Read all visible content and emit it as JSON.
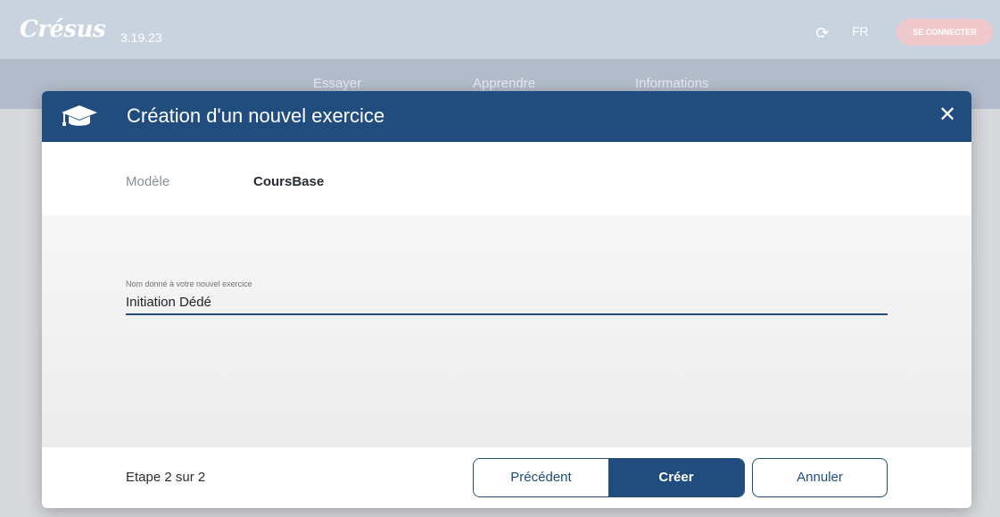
{
  "app": {
    "logo_text": "Crésus",
    "version": "3.19.23",
    "language": "FR",
    "connect_label": "SE CONNECTER",
    "sync_icon": "sync-icon",
    "nav": [
      "Essayer",
      "Apprendre",
      "Informations"
    ]
  },
  "modal": {
    "icon": "graduation-cap-icon",
    "title": "Création d'un nouvel exercice",
    "close_icon": "close-icon",
    "model_label": "Modèle",
    "model_value": "CoursBase",
    "field_label": "Nom donné à votre nouvel exercice",
    "field_value": "Initiation Dédé",
    "step_text": "Etape 2 sur 2",
    "prev_label": "Précédent",
    "create_label": "Créer",
    "cancel_label": "Annuler"
  },
  "colors": {
    "primary": "#214d7e",
    "connect_button": "#f0c9cc",
    "header_dim": "#c9d2df"
  }
}
